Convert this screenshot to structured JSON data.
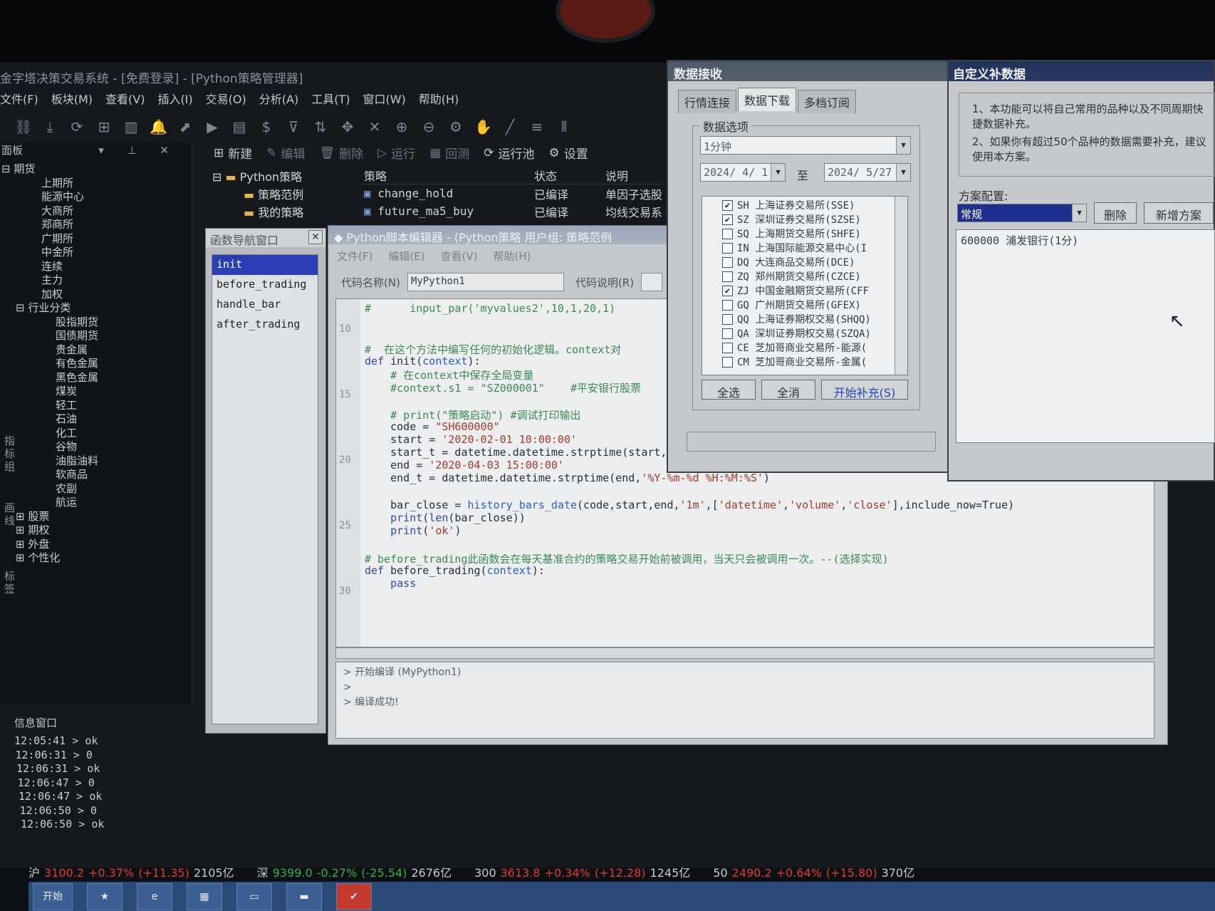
{
  "app": {
    "title": "金字塔决策交易系统 - [免费登录] - [Python策略管理器]",
    "menu": [
      "文件(F)",
      "板块(M)",
      "查看(V)",
      "插入(I)",
      "交易(O)",
      "分析(A)",
      "工具(T)",
      "窗口(W)",
      "帮助(H)"
    ]
  },
  "left_panel": {
    "header": "面板",
    "header_buttons": "▾ ⊥ ✕",
    "tree": [
      {
        "label": "期货",
        "indent": 0,
        "prefix": "⊟"
      },
      {
        "label": "上期所",
        "indent": 2
      },
      {
        "label": "能源中心",
        "indent": 2
      },
      {
        "label": "大商所",
        "indent": 2
      },
      {
        "label": "郑商所",
        "indent": 2
      },
      {
        "label": "广期所",
        "indent": 2
      },
      {
        "label": "中金所",
        "indent": 2
      },
      {
        "label": "连续",
        "indent": 2
      },
      {
        "label": "主力",
        "indent": 2
      },
      {
        "label": "加权",
        "indent": 2
      },
      {
        "label": "行业分类",
        "indent": 1,
        "prefix": "⊟"
      },
      {
        "label": "股指期货",
        "indent": 3
      },
      {
        "label": "国债期货",
        "indent": 3
      },
      {
        "label": "贵金属",
        "indent": 3
      },
      {
        "label": "有色金属",
        "indent": 3
      },
      {
        "label": "黑色金属",
        "indent": 3
      },
      {
        "label": "煤炭",
        "indent": 3
      },
      {
        "label": "轻工",
        "indent": 3
      },
      {
        "label": "石油",
        "indent": 3
      },
      {
        "label": "化工",
        "indent": 3
      },
      {
        "label": "谷物",
        "indent": 3
      },
      {
        "label": "油脂油料",
        "indent": 3
      },
      {
        "label": "软商品",
        "indent": 3
      },
      {
        "label": "农副",
        "indent": 3
      },
      {
        "label": "航运",
        "indent": 3
      },
      {
        "label": "股票",
        "indent": 1,
        "prefix": "⊞"
      },
      {
        "label": "期权",
        "indent": 1,
        "prefix": "⊞"
      },
      {
        "label": "外盘",
        "indent": 1,
        "prefix": "⊞"
      },
      {
        "label": "个性化",
        "indent": 1,
        "prefix": "⊞"
      }
    ],
    "side_tabs": [
      "指标组",
      "画线",
      "标签"
    ]
  },
  "info_window": {
    "title": "信息窗口",
    "lines": [
      "12:05:41 > ok",
      "12:06:31 > 0",
      "12:06:31 > ok",
      "12:06:47 > 0",
      "12:06:47 > ok",
      "12:06:50 > 0",
      "12:06:50 > ok"
    ]
  },
  "strategy_manager": {
    "toolbar": {
      "new": "新建",
      "edit": "编辑",
      "delete": "删除",
      "run": "运行",
      "backtest": "回测",
      "run_pool": "运行池",
      "settings": "设置"
    },
    "tree": {
      "root": "Python策略",
      "child1": "策略范例",
      "child2": "我的策略"
    },
    "table": {
      "headers": [
        "策略",
        "状态",
        "说明"
      ],
      "rows": [
        {
          "name": "change_hold",
          "status": "已编译",
          "desc": "单因子选股"
        },
        {
          "name": "future_ma5_buy",
          "status": "已编译",
          "desc": "均线交易系"
        }
      ]
    }
  },
  "func_nav": {
    "title": "函数导航窗口",
    "items": [
      "init",
      "before_trading",
      "handle_bar",
      "after_trading"
    ],
    "selected": 0
  },
  "editor": {
    "title": "Python脚本编辑器 - (Python策略 用户组: 策略范例",
    "menu": [
      "文件(F)",
      "编辑(E)",
      "查看(V)",
      "帮助(H)"
    ],
    "code_name_label": "代码名称(N)",
    "code_name_value": "MyPython1",
    "code_desc_label": "代码说明(R)",
    "line_numbers": [
      "10",
      "15",
      "20",
      "25",
      "30"
    ],
    "output": [
      "> 开始编译 (MyPython1)",
      ">",
      "> 编译成功!"
    ]
  },
  "data_dialog": {
    "title": "数据接收",
    "tabs": [
      "行情连接",
      "数据下载",
      "多档订阅"
    ],
    "active_tab": 1,
    "group_label": "数据选项",
    "period": "1分钟",
    "date_from": "2024/ 4/ 1",
    "to_label": "至",
    "date_to": "2024/ 5/27",
    "exchanges": [
      {
        "label": "SH 上海证券交易所(SSE)",
        "checked": true
      },
      {
        "label": "SZ 深圳证券交易所(SZSE)",
        "checked": true
      },
      {
        "label": "SQ 上海期货交易所(SHFE)",
        "checked": false
      },
      {
        "label": "IN 上海国际能源交易中心(I",
        "checked": false
      },
      {
        "label": "DQ 大连商品交易所(DCE)",
        "checked": false
      },
      {
        "label": "ZQ 郑州期货交易所(CZCE)",
        "checked": false
      },
      {
        "label": "ZJ 中国金融期货交易所(CFF",
        "checked": true
      },
      {
        "label": "GQ 广州期货交易所(GFEX)",
        "checked": false
      },
      {
        "label": "QQ 上海证券期权交易(SHQQ)",
        "checked": false
      },
      {
        "label": "QA 深圳证券期权交易(SZQA)",
        "checked": false
      },
      {
        "label": "CE 芝加哥商业交易所-能源(",
        "checked": false
      },
      {
        "label": "CM 芝加哥商业交易所-金属(",
        "checked": false
      }
    ],
    "btn_all": "全选",
    "btn_none": "全消",
    "btn_start": "开始补充(S)"
  },
  "custom_dialog": {
    "title": "自定义补数据",
    "desc1": "1、本功能可以将自己常用的品种以及不同周期快捷数据补充。",
    "desc2": "2、如果你有超过50个品种的数据需要补充，建议使用本方案。",
    "scheme_label": "方案配置:",
    "scheme_value": "常规",
    "btn_delete": "删除",
    "btn_new": "新增方案",
    "list_item": "600000 浦发银行(1分)"
  },
  "status_bar": [
    {
      "name": "沪",
      "value": "3100.2",
      "chg": "+0.37%",
      "pts": "(+11.35)",
      "amount": "2105亿",
      "dir": "up"
    },
    {
      "name": "深",
      "value": "9399.0",
      "chg": "-0.27%",
      "pts": "(-25.54)",
      "amount": "2676亿",
      "dir": "dn"
    },
    {
      "name": "300",
      "value": "3613.8",
      "chg": "+0.34%",
      "pts": "(+12.28)",
      "amount": "1245亿",
      "dir": "up"
    },
    {
      "name": "50",
      "value": "2490.2",
      "chg": "+0.64%",
      "pts": "(+15.80)",
      "amount": "370亿",
      "dir": "up"
    }
  ],
  "taskbar": {
    "start": "开始"
  }
}
